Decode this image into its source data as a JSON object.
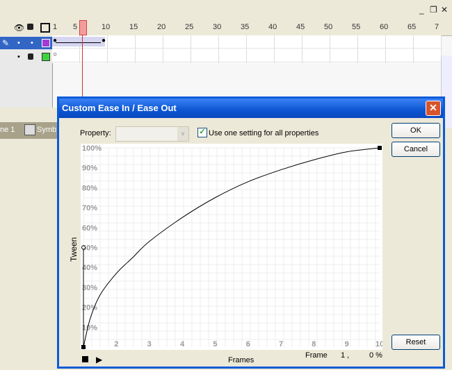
{
  "timeline": {
    "frame_numbers": [
      "1",
      "5",
      "10",
      "15",
      "20",
      "25",
      "30",
      "35",
      "40",
      "45",
      "50",
      "55",
      "60",
      "65",
      "7"
    ],
    "scene_label": "ne 1",
    "symbol_label": "Symb"
  },
  "dialog": {
    "title": "Custom Ease In / Ease Out",
    "close_glyph": "✕",
    "property_label": "Property:",
    "property_value": "",
    "use_one_setting_label": "Use one setting for all properties",
    "use_one_setting_checked": true,
    "ok_label": "OK",
    "cancel_label": "Cancel",
    "reset_label": "Reset",
    "frames_label": "Frames",
    "frame_readout_label": "Frame",
    "frame_readout_value": "1 ,",
    "percent_readout_value": "0 %"
  },
  "chart_data": {
    "type": "line",
    "xlabel": "Frames",
    "ylabel": "Tween",
    "x_ticks": [
      "2",
      "3",
      "4",
      "5",
      "6",
      "7",
      "8",
      "9",
      "10"
    ],
    "y_ticks": [
      "100%",
      "90%",
      "80%",
      "70%",
      "60%",
      "50%",
      "40%",
      "30%",
      "20%",
      "10%"
    ],
    "xlim": [
      1,
      10
    ],
    "ylim": [
      0,
      100
    ],
    "grid": true,
    "series": [
      {
        "points": [
          [
            1,
            0
          ],
          [
            1.2,
            14
          ],
          [
            1.5,
            26
          ],
          [
            2,
            37
          ],
          [
            2.5,
            45
          ],
          [
            3,
            53
          ],
          [
            4,
            65
          ],
          [
            5,
            75
          ],
          [
            6,
            83
          ],
          [
            7,
            89
          ],
          [
            8,
            94
          ],
          [
            9,
            98
          ],
          [
            10,
            100
          ]
        ]
      }
    ]
  }
}
